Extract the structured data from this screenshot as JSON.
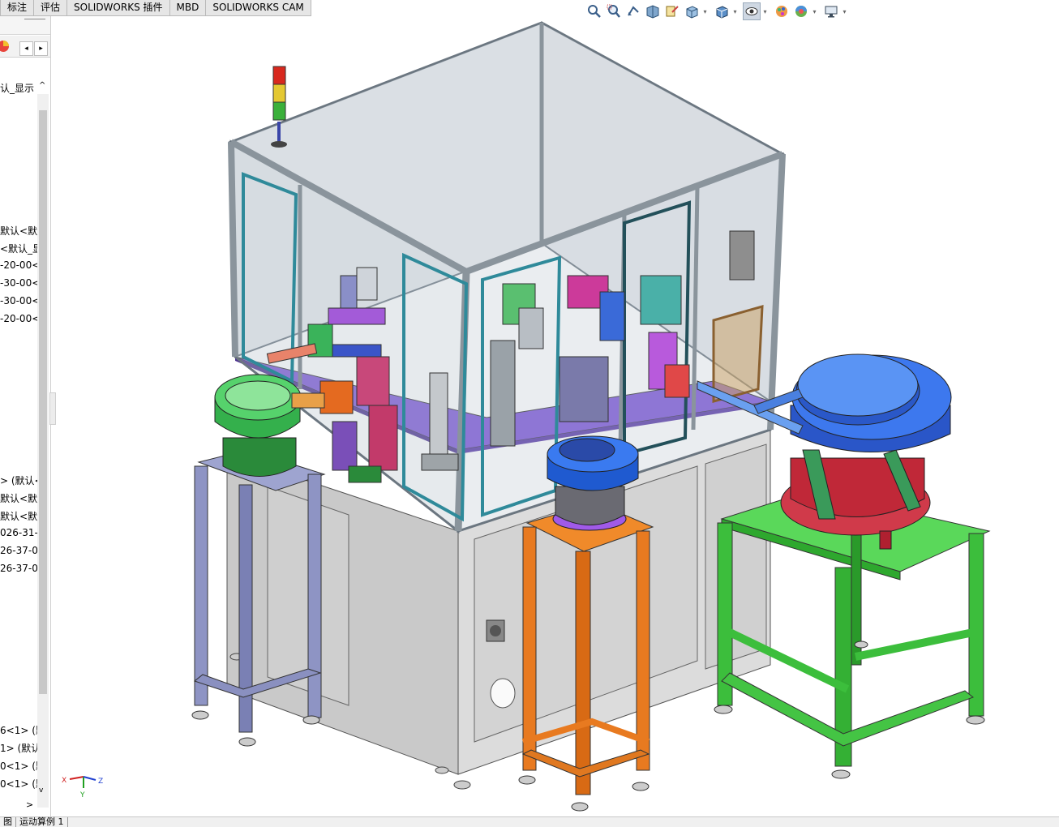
{
  "tabs": [
    "标注",
    "评估",
    "SOLIDWORKS 插件",
    "MBD",
    "SOLIDWORKS CAM"
  ],
  "toolbar_icons": [
    "zoom-to-fit-icon",
    "zoom-to-area-icon",
    "previous-view-icon",
    "section-view-icon",
    "dynamic-annotation-icon",
    "view-orientation-icon",
    "display-style-icon",
    "hide-show-items-icon",
    "edit-appearance-icon",
    "apply-scene-icon",
    "view-settings-icon"
  ],
  "sidebar": {
    "display_state_label": "认_显示",
    "tree": [
      "默认<默认",
      "<默认_显",
      "-20-00<",
      "-30-00<",
      "-30-00<",
      "-20-00<",
      "> (默认<",
      "默认<默",
      "默认<默",
      "026-31-",
      "26-37-0",
      "26-37-0",
      "6<1> (默",
      "1> (默认",
      "0<1> (默",
      "0<1> (默"
    ]
  },
  "bottom_tabs": [
    "图",
    "运动算例 1"
  ],
  "triad": {
    "x": "X",
    "y": "Y",
    "z": "Z"
  }
}
